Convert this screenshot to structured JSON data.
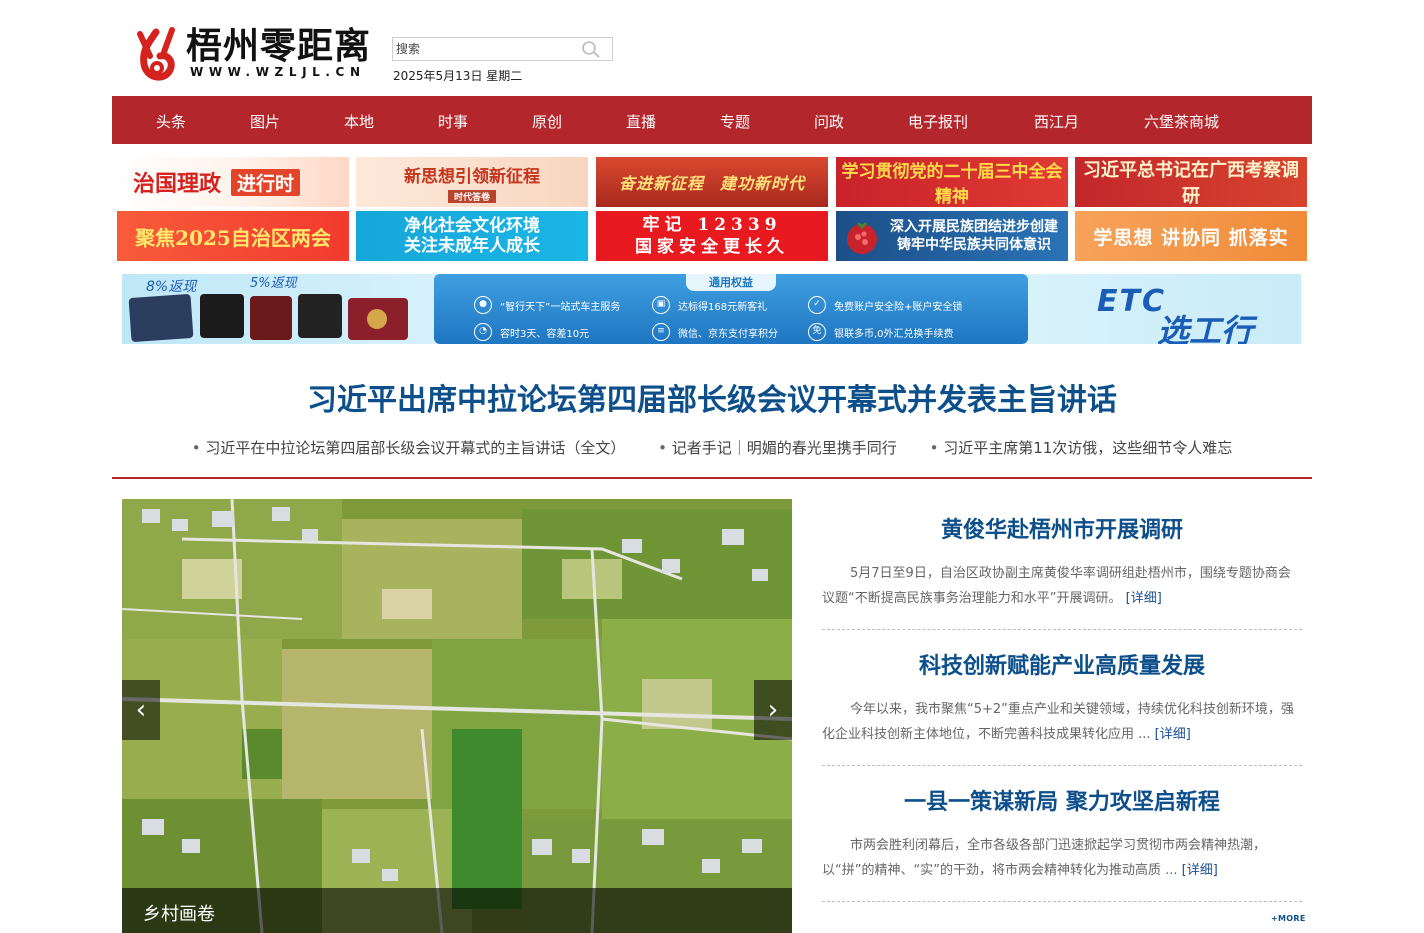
{
  "site": {
    "logo_title": "梧州零距离",
    "logo_subtitle": "WWW.WZLJL.CN"
  },
  "search": {
    "placeholder": "搜索"
  },
  "date": "2025年5月13日 星期二",
  "nav": [
    "头条",
    "图片",
    "本地",
    "时事",
    "原创",
    "直播",
    "专题",
    "问政",
    "电子报刊",
    "西江月",
    "六堡茶商城"
  ],
  "banners": {
    "b1_main": "治国理政",
    "b1_tag": "进行时",
    "b2_main": "新思想引领新征程",
    "b2_small": "时代答卷",
    "b3_left": "奋进新征程",
    "b3_right": "建功新时代",
    "b4": "学习贯彻党的二十届三中全会精神",
    "b5": "习近平总书记在广西考察调研",
    "b6": "聚焦2025自治区两会",
    "b7_line1": "净化社会文化环境",
    "b7_line2": "关注未成年人成长",
    "b8_line1": "牢记 12339",
    "b8_line2": "国家安全更长久",
    "b9_line1": "深入开展民族团结进步创建",
    "b9_line2": "铸牢中华民族共同体意识",
    "b10": "学思想 讲协同 抓落实"
  },
  "ad": {
    "rate1": "8%返现",
    "rate2": "5%返现",
    "panel_title": "通用权益",
    "features": [
      "“智行天下”一站式车主服务",
      "达标得168元新客礼",
      "免费账户安全险+账户安全锁",
      "容时3天、容差10元",
      "微信、京东支付享积分",
      "银联多币,0外汇兑换手续费"
    ],
    "brand": "ETC",
    "slogan": "选工行"
  },
  "headline": "习近平出席中拉论坛第四届部长级会议开幕式并发表主旨讲话",
  "sublinks": [
    "习近平在中拉论坛第四届部长级会议开幕式的主旨讲话（全文）",
    "记者手记｜明媚的春光里携手同行",
    "习近平主席第11次访俄，这些细节令人难忘"
  ],
  "slideshow": {
    "caption": "乡村画卷"
  },
  "news": [
    {
      "title": "黄俊华赴梧州市开展调研",
      "summary": "5月7日至9日，自治区政协副主席黄俊华率调研组赴梧州市，围绕专题协商会议题“不断提高民族事务治理能力和水平”开展调研。",
      "link": "[详细]"
    },
    {
      "title": "科技创新赋能产业高质量发展",
      "summary": "今年以来，我市聚焦“5+2”重点产业和关键领域，持续优化科技创新环境，强化企业科技创新主体地位，不断完善科技成果转化应用 ...",
      "link": "[详细]"
    },
    {
      "title": "一县一策谋新局 聚力攻坚启新程",
      "summary": "市两会胜利闭幕后，全市各级各部门迅速掀起学习贯彻市两会精神热潮，以“拼”的精神、“实”的干劲，将市两会精神转化为推动高质 ...",
      "link": "[详细]"
    }
  ],
  "more": "+MORE",
  "colors": {
    "brand_red": "#b3262b",
    "headline_blue": "#0d4f8b"
  }
}
